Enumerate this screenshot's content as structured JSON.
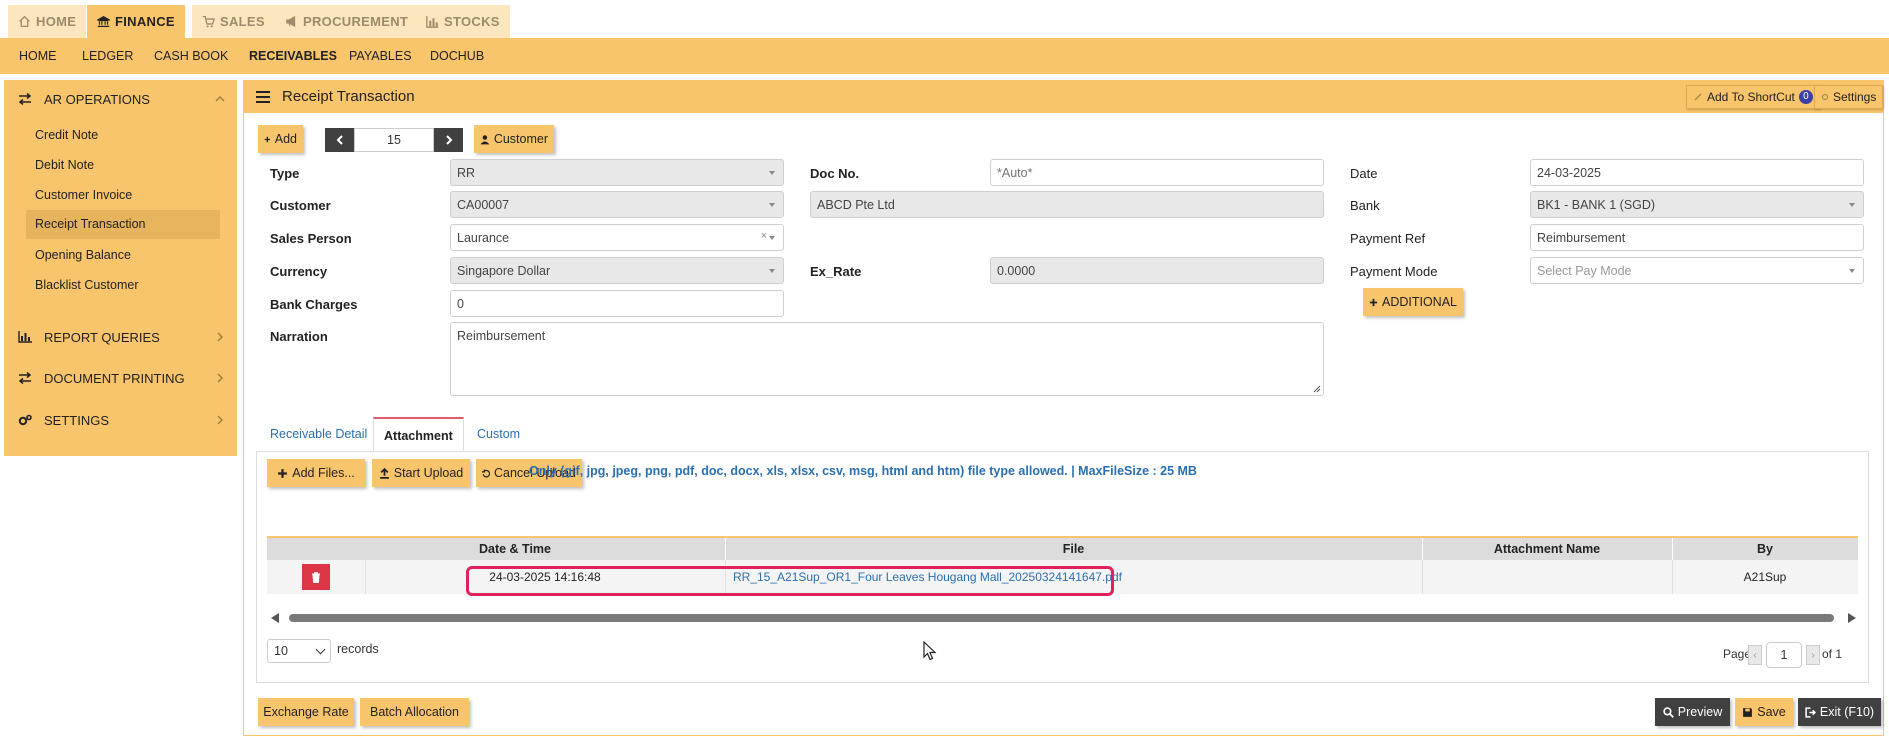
{
  "top_tabs": [
    {
      "label": "HOME",
      "icon": "home-icon"
    },
    {
      "label": "FINANCE",
      "icon": "bank-icon"
    },
    {
      "label": "SALES",
      "icon": "cart-icon"
    },
    {
      "label": "PROCUREMENT",
      "icon": "megaphone-icon"
    },
    {
      "label": "STOCKS",
      "icon": "bar-chart-icon"
    }
  ],
  "active_top_tab": "FINANCE",
  "subnav": [
    "HOME",
    "LEDGER",
    "CASH BOOK",
    "RECEIVABLES",
    "PAYABLES",
    "DOCHUB"
  ],
  "active_subnav": "RECEIVABLES",
  "sidebar": {
    "section": "AR OPERATIONS",
    "items": [
      "Credit Note",
      "Debit Note",
      "Customer Invoice",
      "Receipt Transaction",
      "Opening Balance",
      "Blacklist Customer"
    ],
    "active_item": "Receipt Transaction",
    "other_sections": [
      "REPORT QUERIES",
      "DOCUMENT PRINTING",
      "SETTINGS"
    ]
  },
  "panel": {
    "title": "Receipt Transaction",
    "shortcut_label": "Add To ShortCut",
    "shortcut_count": "0",
    "settings_label": "Settings"
  },
  "toolbar": {
    "add_label": "Add",
    "record_number": "15",
    "customer_label": "Customer"
  },
  "form": {
    "type_label": "Type",
    "type_value": "RR",
    "customer_label": "Customer",
    "customer_code": "CA00007",
    "customer_name": "ABCD Pte Ltd",
    "sales_person_label": "Sales Person",
    "sales_person_value": "Laurance",
    "currency_label": "Currency",
    "currency_value": "Singapore Dollar",
    "bank_charges_label": "Bank Charges",
    "bank_charges_value": "0",
    "narration_label": "Narration",
    "narration_value": "Reimbursement",
    "doc_no_label": "Doc No.",
    "doc_no_placeholder": "*Auto*",
    "ex_rate_label": "Ex_Rate",
    "ex_rate_value": "0.0000",
    "date_label": "Date",
    "date_value": "24-03-2025",
    "bank_label": "Bank",
    "bank_value": "BK1 - BANK 1 (SGD)",
    "payment_ref_label": "Payment Ref",
    "payment_ref_value": "Reimbursement",
    "payment_mode_label": "Payment Mode",
    "payment_mode_placeholder": "Select Pay Mode",
    "additional_label": "ADDITIONAL"
  },
  "tabs": [
    "Receivable Detail",
    "Attachment",
    "Custom"
  ],
  "active_tab": "Attachment",
  "attachment": {
    "add_files_label": "Add Files...",
    "start_upload_label": "Start Upload",
    "cancel_upload_label": "Cancel Upload",
    "note": "Only (gif, jpg, jpeg, png, pdf, doc, docx, xls, xlsx, csv, msg, html and htm) file type allowed. | MaxFileSize : 25 MB",
    "columns": [
      "Date & Time",
      "File",
      "Attachment Name",
      "By"
    ],
    "rows": [
      {
        "datetime": "24-03-2025 14:16:48",
        "file": "RR_15_A21Sup_OR1_Four Leaves Hougang Mall_20250324141647.pdf",
        "attachment_name": "",
        "by": "A21Sup"
      }
    ],
    "page_size": "10",
    "records_label": "records",
    "page_label": "Page",
    "page_value": "1",
    "page_of": "of 1"
  },
  "footer": {
    "exchange_rate_label": "Exchange Rate",
    "batch_allocation_label": "Batch Allocation",
    "preview_label": "Preview",
    "save_label": "Save",
    "exit_label": "Exit (F10)"
  },
  "colors": {
    "accent": "#f8c56c",
    "accent_light": "#fbe6bd",
    "sidebar_active": "#e6b45d",
    "dark_button": "#404040",
    "delete_button": "#dc3545",
    "highlight": "#e0225c",
    "link": "#2b6fae"
  }
}
